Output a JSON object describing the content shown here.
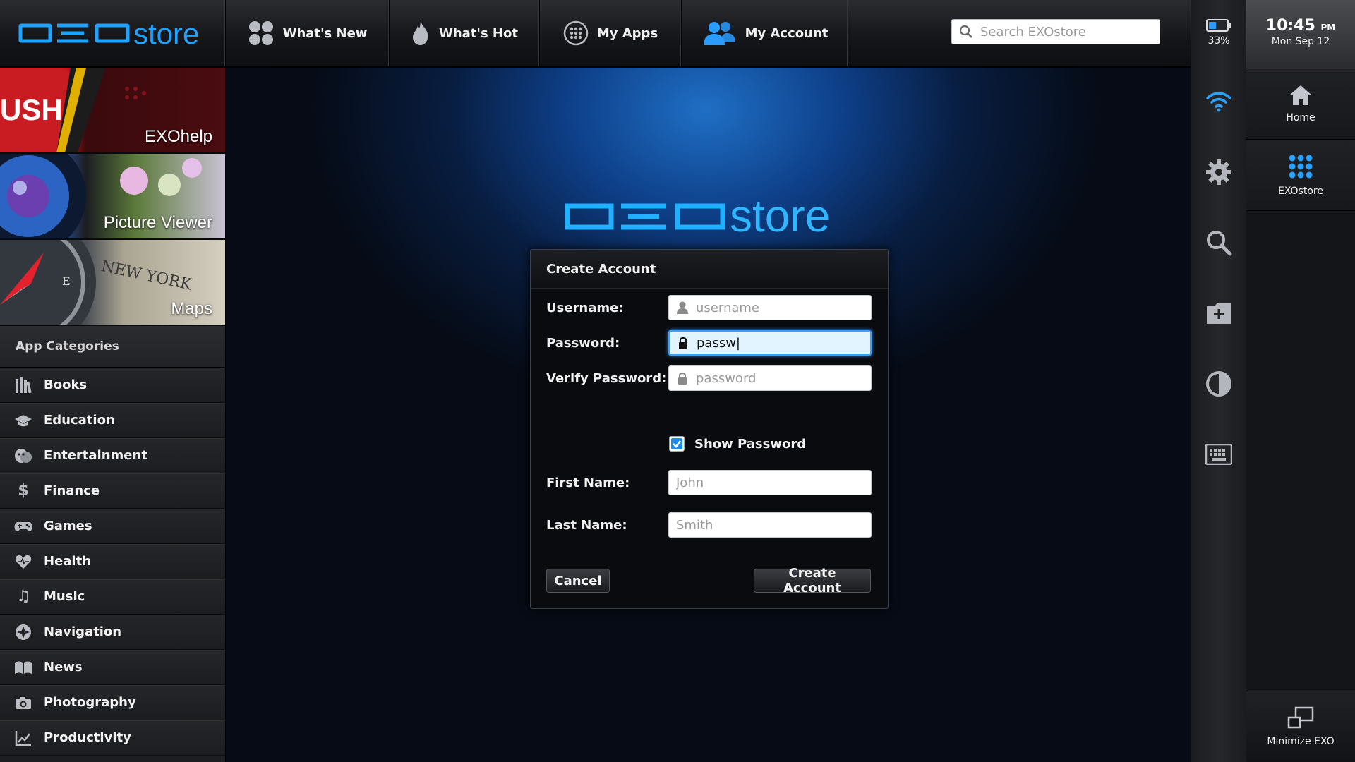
{
  "app": {
    "logo_text": "store",
    "brand_color": "#1fa3ff"
  },
  "nav": {
    "tabs": [
      {
        "label": "What's New",
        "icon": "dots-grid-icon"
      },
      {
        "label": "What's Hot",
        "icon": "flame-icon"
      },
      {
        "label": "My Apps",
        "icon": "apps-circle-icon"
      },
      {
        "label": "My Account",
        "icon": "users-icon",
        "active": true
      }
    ],
    "search_placeholder": "Search EXOstore"
  },
  "sidebar": {
    "tiles": [
      {
        "label": "EXOhelp",
        "overlay_text": "USH"
      },
      {
        "label": "Picture Viewer"
      },
      {
        "label": "Maps"
      }
    ],
    "categories_header": "App Categories",
    "categories": [
      {
        "label": "Books",
        "icon": "books-icon"
      },
      {
        "label": "Education",
        "icon": "graduation-cap-icon"
      },
      {
        "label": "Entertainment",
        "icon": "masks-icon"
      },
      {
        "label": "Finance",
        "icon": "dollar-icon"
      },
      {
        "label": "Games",
        "icon": "gamepad-icon"
      },
      {
        "label": "Health",
        "icon": "heart-icon"
      },
      {
        "label": "Music",
        "icon": "music-note-icon"
      },
      {
        "label": "Navigation",
        "icon": "compass-icon"
      },
      {
        "label": "News",
        "icon": "newspaper-icon"
      },
      {
        "label": "Photography",
        "icon": "camera-icon"
      },
      {
        "label": "Productivity",
        "icon": "chart-icon"
      }
    ]
  },
  "dialog": {
    "title": "Create Account",
    "username": {
      "label": "Username:",
      "value": "",
      "placeholder": "username"
    },
    "password": {
      "label": "Password:",
      "value": "passw|",
      "placeholder": "password"
    },
    "verify_password": {
      "label": "Verify Password:",
      "value": "",
      "placeholder": "password"
    },
    "show_password": {
      "label": "Show Password",
      "checked": true
    },
    "first_name": {
      "label": "First Name:",
      "value": "",
      "placeholder": "John"
    },
    "last_name": {
      "label": "Last Name:",
      "value": "",
      "placeholder": "Smith"
    },
    "cancel_label": "Cancel",
    "create_label": "Create Account"
  },
  "system": {
    "battery_percent": "33%",
    "icons": [
      "battery-icon",
      "wifi-icon",
      "gear-icon",
      "search-icon",
      "folder-add-icon",
      "contrast-icon",
      "keyboard-icon"
    ]
  },
  "launcher": {
    "time": "10:45",
    "ampm": "PM",
    "date": "Mon Sep 12",
    "home_label": "Home",
    "store_label": "EXOstore",
    "minimize_label": "Minimize EXO"
  }
}
